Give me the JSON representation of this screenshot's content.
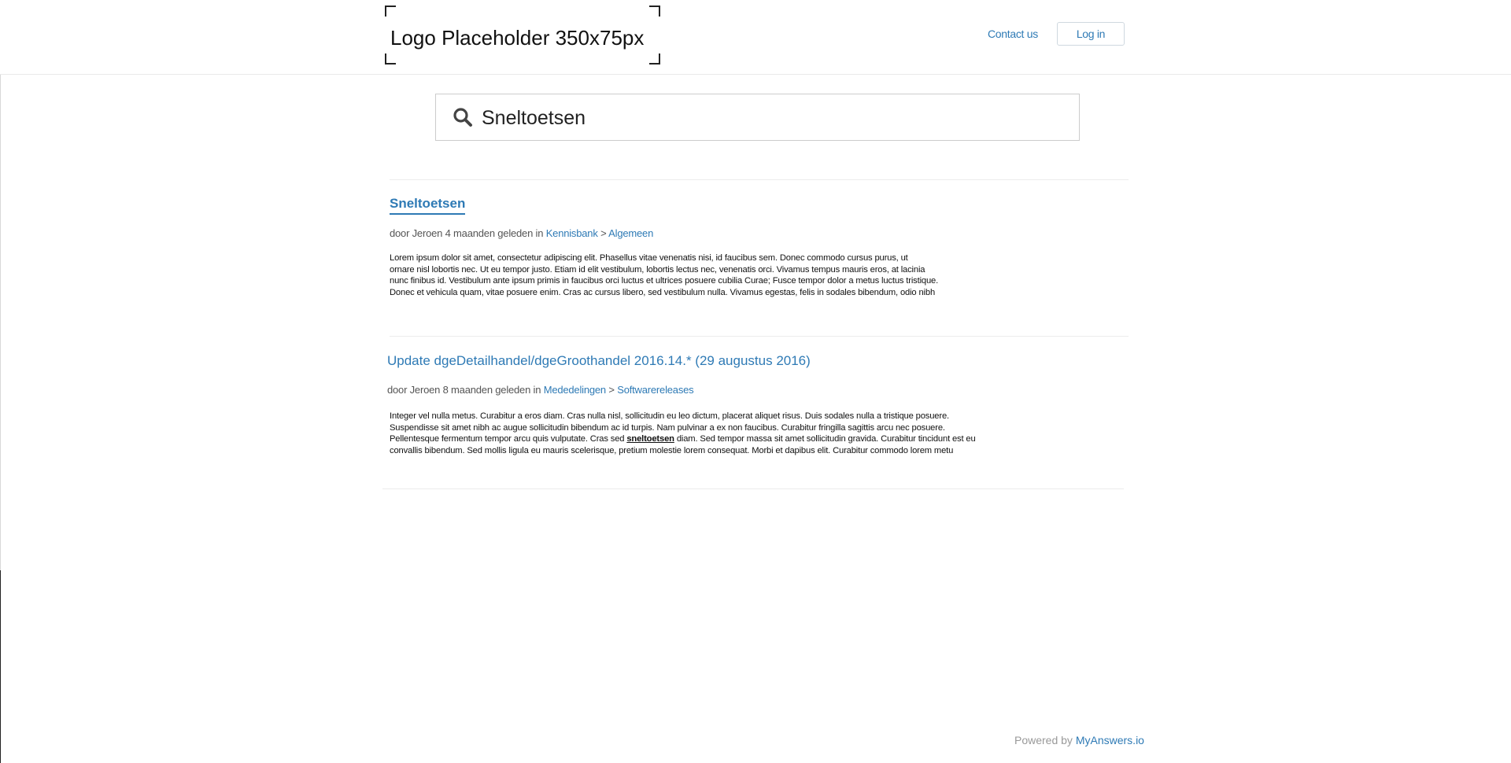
{
  "header": {
    "logo_text": "Logo Placeholder 350x75px",
    "contact_label": "Contact us",
    "login_label": "Log in"
  },
  "search": {
    "value": "Sneltoetsen",
    "icon": "search-icon"
  },
  "results": [
    {
      "title": "Sneltoetsen",
      "meta_prefix": "door Jeroen 4 maanden geleden in",
      "category": "Kennisbank",
      "separator": ">",
      "subcategory": "Algemeen",
      "excerpt_lines": [
        "Lorem ipsum dolor sit amet, consectetur adipiscing elit. Phasellus vitae venenatis nisi, id faucibus sem. Donec commodo cursus purus, ut",
        "ornare nisl lobortis nec. Ut eu tempor justo. Etiam id elit vestibulum, lobortis lectus nec, venenatis orci. Vivamus tempus mauris eros, at lacinia",
        "nunc finibus id. Vestibulum ante ipsum primis in faucibus orci luctus et ultrices posuere cubilia Curae; Fusce tempor dolor a metus luctus tristique.",
        "Donec et vehicula quam, vitae posuere enim. Cras ac cursus libero, sed vestibulum nulla. Vivamus egestas, felis in sodales bibendum, odio nibh"
      ]
    },
    {
      "title": "Update dgeDetailhandel/dgeGroothandel 2016.14.* (29 augustus 2016)",
      "meta_prefix": "door Jeroen 8 maanden geleden in",
      "category": "Mededelingen",
      "separator": ">",
      "subcategory": "Softwarereleases",
      "excerpt_lines": [
        "Integer vel nulla metus. Curabitur a eros diam. Cras nulla nisl, sollicitudin eu leo dictum, placerat aliquet risus. Duis sodales nulla a tristique posuere.",
        "Suspendisse sit amet nibh ac augue sollicitudin bibendum ac id turpis. Nam pulvinar a ex non faucibus. Curabitur fringilla sagittis arcu nec posuere.",
        "convallis bibendum. Sed mollis ligula eu mauris scelerisque, pretium molestie lorem consequat. Morbi et dapibus elit. Curabitur commodo lorem metu"
      ],
      "excerpt_highlight_before": "Pellentesque fermentum tempor arcu quis vulputate. Cras sed",
      "excerpt_highlight": "sneltoetsen",
      "excerpt_highlight_after": "diam. Sed tempor massa sit amet sollicitudin gravida. Curabitur tincidunt est eu"
    }
  ],
  "footer": {
    "powered_by": "Powered by",
    "brand": "MyAnswers.io"
  },
  "colors": {
    "link": "#2e7ab5",
    "text": "#111111",
    "muted": "#999999"
  }
}
